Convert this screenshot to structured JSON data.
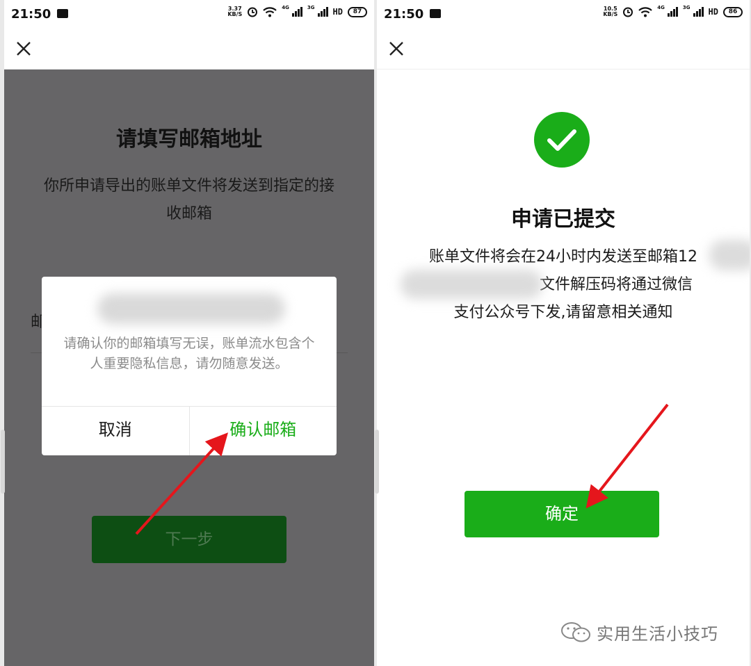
{
  "left_screen": {
    "status": {
      "time": "21:50",
      "speed_value": "3.37",
      "speed_unit": "KB/S",
      "net1": "4G",
      "net2": "3G",
      "hd": "HD",
      "battery": "87"
    },
    "title": "请填写邮箱地址",
    "description": "你所申请导出的账单文件将发送到指定的接收邮箱",
    "email_label_partial": "邮",
    "next_button": "下一步",
    "dialog": {
      "message": "请确认你的邮箱填写无误，账单流水包含个人重要隐私信息，请勿随意发送。",
      "cancel": "取消",
      "confirm": "确认邮箱"
    }
  },
  "right_screen": {
    "status": {
      "time": "21:50",
      "speed_value": "10.5",
      "speed_unit": "KB/S",
      "net1": "4G",
      "net2": "3G",
      "hd": "HD",
      "battery": "86"
    },
    "title": "申请已提交",
    "description_line1": "账单文件将会在24小时内发送至邮箱12",
    "description_line2": "文件解压码将通过微信",
    "description_line3": "支付公众号下发,请留意相关通知",
    "ok_button": "确定"
  },
  "watermark": {
    "text": "实用生活小技巧",
    "icon": "wechat-icon"
  },
  "colors": {
    "accent": "#1aad19",
    "overlay": "#666567",
    "annotation_arrow": "#e5161c"
  }
}
